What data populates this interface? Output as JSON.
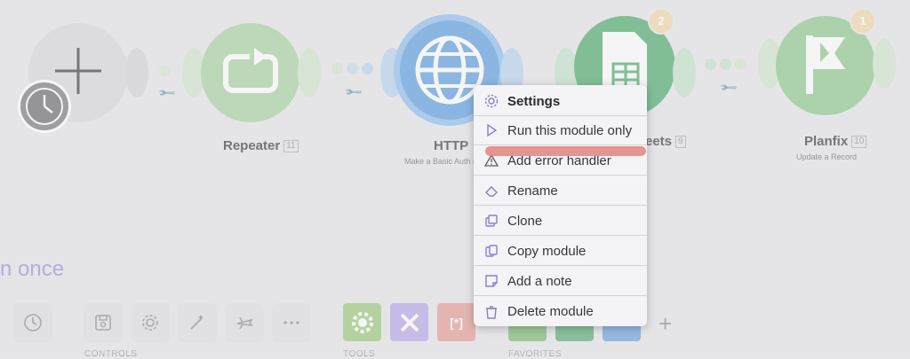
{
  "nodes": {
    "repeater": {
      "label": "Repeater",
      "index": "11"
    },
    "http": {
      "label": "HTTP",
      "subtitle": "Make a Basic Auth r"
    },
    "sheets": {
      "label_partial": "eets",
      "index": "9",
      "badge": "2"
    },
    "planfix": {
      "label": "Planfix",
      "index": "10",
      "subtitle": "Update a Record",
      "badge": "1"
    }
  },
  "run_once_text": "n once",
  "context_menu": {
    "items": [
      {
        "label": "Settings",
        "icon": "gear-icon"
      },
      {
        "label": "Run this module only",
        "icon": "play-icon"
      },
      {
        "label": "Add error handler",
        "icon": "warning-icon"
      },
      {
        "label": "Rename",
        "icon": "eraser-icon"
      },
      {
        "label": "Clone",
        "icon": "clone-icon"
      },
      {
        "label": "Copy module",
        "icon": "copy-icon"
      },
      {
        "label": "Add a note",
        "icon": "note-icon"
      },
      {
        "label": "Delete module",
        "icon": "trash-icon"
      }
    ]
  },
  "bottom_toolbar": {
    "controls_label": "CONTROLS",
    "tools_label": "TOOLS",
    "favorites_label": "FAVORITES"
  },
  "colors": {
    "repeater": "#a9d3a0",
    "http": "#5d9fe0",
    "sheets": "#4dab6a",
    "planfix": "#8ec98a",
    "accent_purple": "#8e7cd0",
    "highlight_red": "#e58a85"
  }
}
